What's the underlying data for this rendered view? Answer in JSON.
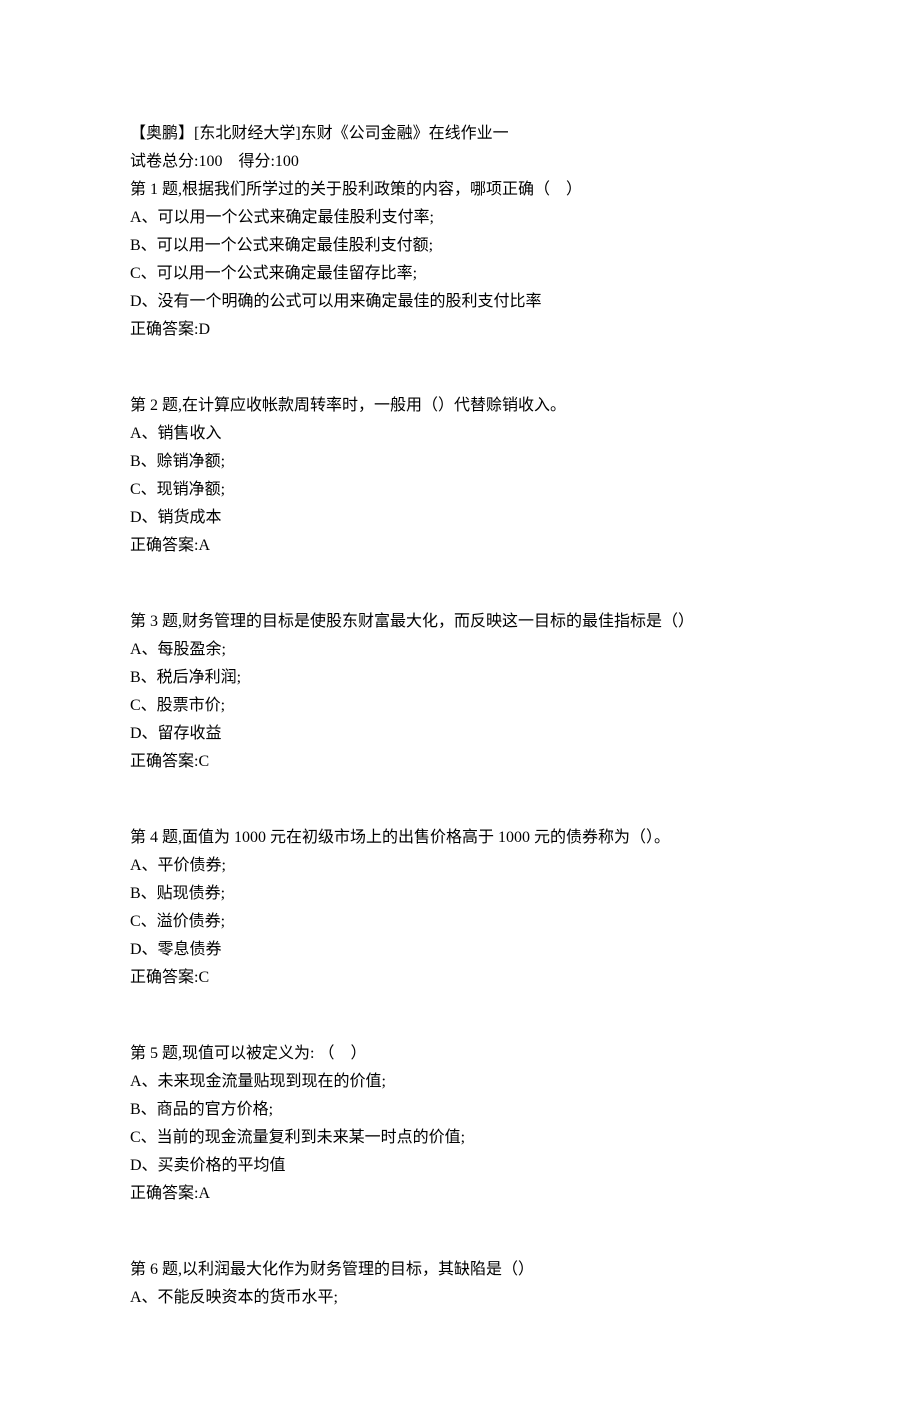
{
  "header": {
    "title": "【奥鹏】[东北财经大学]东财《公司金融》在线作业一",
    "total_label": "试卷总分:",
    "total_value": "100",
    "score_label": "得分:",
    "score_value": "100"
  },
  "answer_prefix": "正确答案:",
  "questions": [
    {
      "stem": "第 1 题,根据我们所学过的关于股利政策的内容，哪项正确（　）",
      "options": [
        "A、可以用一个公式来确定最佳股利支付率;",
        "B、可以用一个公式来确定最佳股利支付额;",
        "C、可以用一个公式来确定最佳留存比率;",
        "D、没有一个明确的公式可以用来确定最佳的股利支付比率"
      ],
      "answer": "D"
    },
    {
      "stem": "第 2 题,在计算应收帐款周转率时，一般用（）代替赊销收入。",
      "options": [
        "A、销售收入",
        "B、赊销净额;",
        "C、现销净额;",
        "D、销货成本"
      ],
      "answer": "A"
    },
    {
      "stem": "第 3 题,财务管理的目标是使股东财富最大化，而反映这一目标的最佳指标是（）",
      "options": [
        "A、每股盈余;",
        "B、税后净利润;",
        "C、股票市价;",
        "D、留存收益"
      ],
      "answer": "C"
    },
    {
      "stem": "第 4 题,面值为 1000 元在初级市场上的出售价格高于 1000 元的债券称为（）。",
      "options": [
        "A、平价债券;",
        "B、贴现债券;",
        "C、溢价债券;",
        "D、零息债券"
      ],
      "answer": "C"
    },
    {
      "stem": "第 5 题,现值可以被定义为: （　）",
      "options": [
        "A、未来现金流量贴现到现在的价值;",
        "B、商品的官方价格;",
        "C、当前的现金流量复利到未来某一时点的价值;",
        "D、买卖价格的平均值"
      ],
      "answer": "A"
    },
    {
      "stem": "第 6 题,以利润最大化作为财务管理的目标，其缺陷是（）",
      "options": [
        "A、不能反映资本的货币水平;"
      ],
      "answer": ""
    }
  ]
}
